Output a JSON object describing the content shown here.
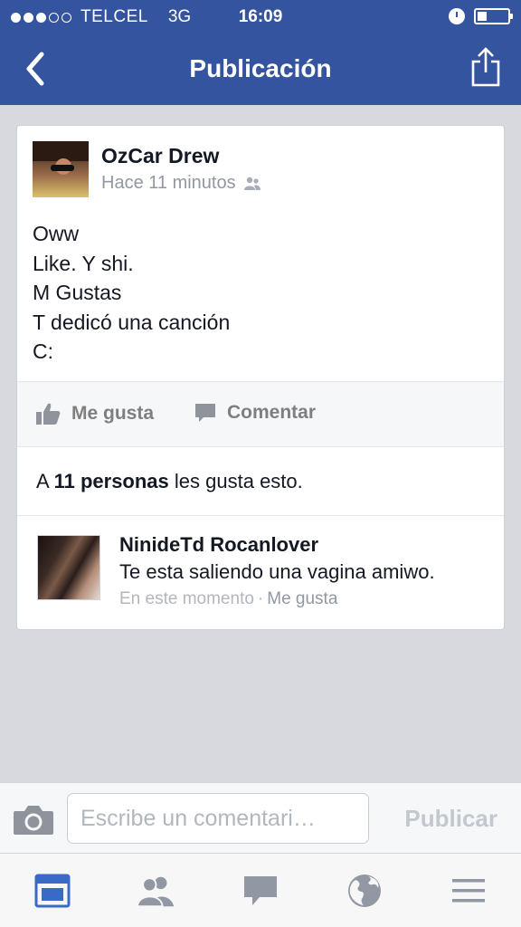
{
  "status_bar": {
    "signal_bars_filled": 3,
    "signal_bars_total": 5,
    "carrier": "TELCEL",
    "network": "3G",
    "time": "16:09",
    "battery_level": 0.3
  },
  "nav": {
    "title": "Publicación",
    "back_icon": "chevron-left-icon",
    "share_icon": "share-icon"
  },
  "post": {
    "author": "OzCar Drew",
    "time": "Hace 11 minutos",
    "audience_icon": "friends-icon",
    "lines": [
      "Oww",
      "Like. Y shi.",
      "M Gustas",
      "T dedicó una canción",
      "C:"
    ],
    "actions": {
      "like_label": "Me gusta",
      "comment_label": "Comentar"
    },
    "likes": {
      "prefix": "A",
      "count_text": "11 personas",
      "suffix": "les gusta esto."
    }
  },
  "comment": {
    "author": "NinideTd Rocanlover",
    "text": "Te esta saliendo una vagina amiwo.",
    "time": "En este momento",
    "separator": "·",
    "like_label": "Me gusta"
  },
  "composer": {
    "placeholder": "Escribe un comentari…",
    "value": "",
    "publish_label": "Publicar"
  },
  "tabbar": {
    "items": [
      "news-feed-icon",
      "friends-requests-icon",
      "messages-icon",
      "notifications-globe-icon",
      "menu-icon"
    ],
    "active_index": 0
  },
  "colors": {
    "brand": "#35549f",
    "active_tab": "#3b69c7",
    "inactive_tab": "#9197a3"
  }
}
